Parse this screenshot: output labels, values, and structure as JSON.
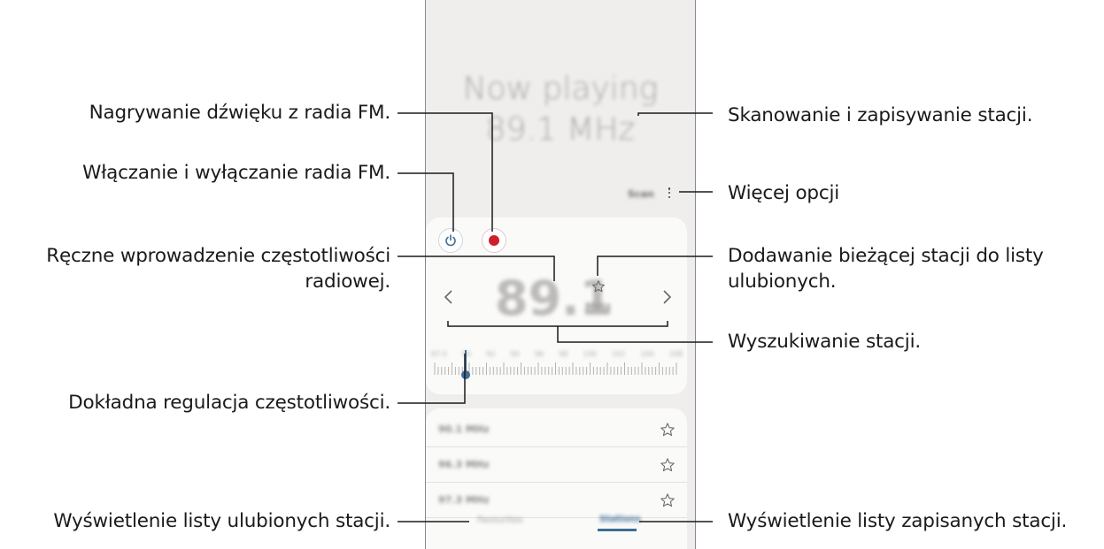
{
  "phone": {
    "now_playing_line1": "Now playing",
    "now_playing_line2": "89.1 MHz",
    "scan_label": "Scan",
    "frequency_value": "89.1",
    "frequency_unit": "MHz",
    "dial_scale": [
      "87.5",
      "90",
      "92",
      "94",
      "96",
      "98",
      "100",
      "102",
      "104",
      "108"
    ],
    "stations": [
      {
        "label": "90.1 MHz"
      },
      {
        "label": "96.3 MHz"
      },
      {
        "label": "97.3 MHz"
      }
    ],
    "tabs": {
      "favourites": "Favourites",
      "all_stations": "Stations"
    },
    "accent_color": "#3c6d95",
    "record_color": "#d01f2b"
  },
  "callouts": {
    "record": "Nagrywanie dźwięku z radia FM.",
    "power": "Włączanie i wyłączanie radia FM.",
    "manual_freq_line1": "Ręczne wprowadzenie częstotliwości",
    "manual_freq_line2": "radiowej.",
    "fine_tune": "Dokładna regulacja częstotliwości.",
    "favourites_list": "Wyświetlenie listy ulubionych stacji.",
    "scan_save": "Skanowanie i zapisywanie stacji.",
    "more_options": "Więcej opcji",
    "add_favourite_line1": "Dodawanie bieżącej stacji do listy",
    "add_favourite_line2": "ulubionych.",
    "search_stations": "Wyszukiwanie stacji.",
    "saved_list": "Wyświetlenie listy zapisanych stacji."
  }
}
